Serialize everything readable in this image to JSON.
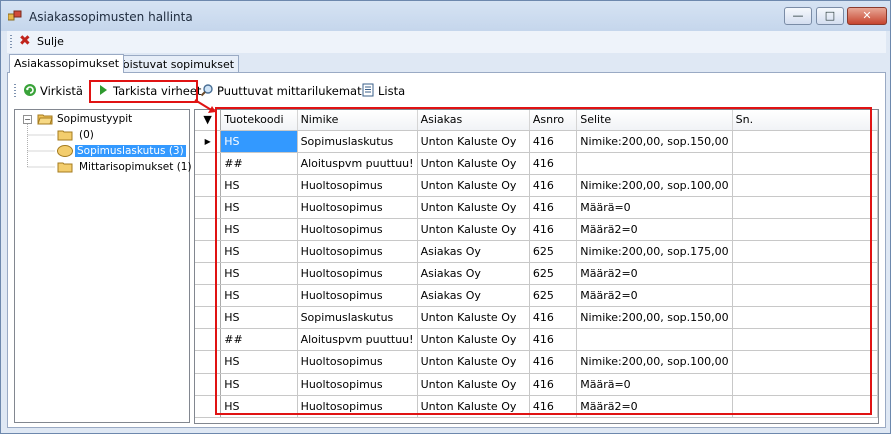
{
  "window": {
    "title": "Asiakassopimusten hallinta",
    "controls": {
      "minimize": "—",
      "maximize": "□",
      "close": "✕"
    }
  },
  "menubar": {
    "close_label": "Sulje"
  },
  "tabs": [
    {
      "label": "Asiakassopimukset",
      "active": true
    },
    {
      "label": "Toistuvat sopimukset",
      "active": false
    }
  ],
  "toolbar": {
    "refresh_label": "Virkistä",
    "check_errors_label": "Tarkista virheet",
    "missing_readings_label": "Puuttuvat mittarilukemat",
    "list_label": "Lista"
  },
  "tree": {
    "root": "Sopimustyypit",
    "children": [
      {
        "label": "(0)"
      },
      {
        "label": "Sopimuslaskutus (3)",
        "selected": true
      },
      {
        "label": "Mittarisopimukset (1)"
      }
    ]
  },
  "grid": {
    "columns": [
      "Tuotekoodi",
      "Nimike",
      "Asiakas",
      "Asnro",
      "Selite",
      "Sn."
    ],
    "rows": [
      [
        "HS",
        "Sopimuslaskutus",
        "Unton Kaluste Oy",
        "416",
        "Nimike:200,00, sop.150,00",
        ""
      ],
      [
        "##",
        "Aloituspvm puuttuu!",
        "Unton Kaluste Oy",
        "416",
        "",
        ""
      ],
      [
        "HS",
        "Huoltosopimus",
        "Unton Kaluste Oy",
        "416",
        "Nimike:200,00, sop.100,00",
        ""
      ],
      [
        "HS",
        "Huoltosopimus",
        "Unton Kaluste Oy",
        "416",
        "Määrä=0",
        ""
      ],
      [
        "HS",
        "Huoltosopimus",
        "Unton Kaluste Oy",
        "416",
        "Määrä2=0",
        ""
      ],
      [
        "HS",
        "Huoltosopimus",
        "Asiakas Oy",
        "625",
        "Nimike:200,00, sop.175,00",
        ""
      ],
      [
        "HS",
        "Huoltosopimus",
        "Asiakas Oy",
        "625",
        "Määrä2=0",
        ""
      ],
      [
        "HS",
        "Huoltosopimus",
        "Asiakas Oy",
        "625",
        "Määrä2=0",
        ""
      ],
      [
        "HS",
        "Sopimuslaskutus",
        "Unton Kaluste Oy",
        "416",
        "Nimike:200,00, sop.150,00",
        ""
      ],
      [
        "##",
        "Aloituspvm puuttuu!",
        "Unton Kaluste Oy",
        "416",
        "",
        ""
      ],
      [
        "HS",
        "Huoltosopimus",
        "Unton Kaluste Oy",
        "416",
        "Nimike:200,00, sop.100,00",
        ""
      ],
      [
        "HS",
        "Huoltosopimus",
        "Unton Kaluste Oy",
        "416",
        "Määrä=0",
        ""
      ],
      [
        "HS",
        "Huoltosopimus",
        "Unton Kaluste Oy",
        "416",
        "Määrä2=0",
        ""
      ]
    ]
  },
  "colors": {
    "highlight": "#e01313",
    "selection": "#3399ff"
  }
}
